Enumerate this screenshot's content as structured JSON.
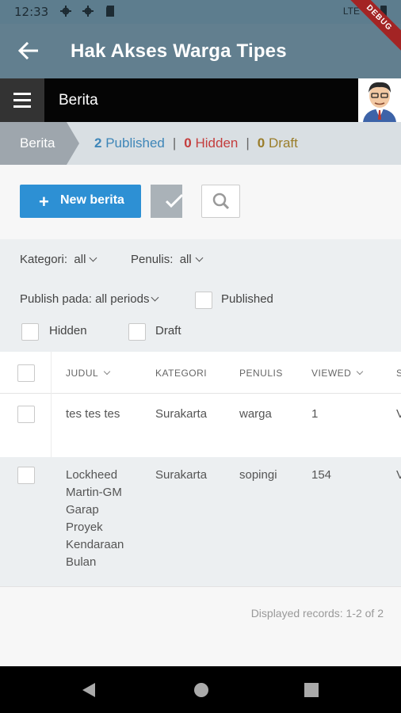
{
  "status_bar": {
    "time": "12:33",
    "network": "LTE"
  },
  "debug_banner": "DEBUG",
  "app_bar": {
    "title": "Hak Akses Warga Tipes"
  },
  "top_nav": {
    "section": "Berita"
  },
  "breadcrumb": {
    "current": "Berita",
    "published_count": "2",
    "published_label": "Published",
    "hidden_count": "0",
    "hidden_label": "Hidden",
    "draft_count": "0",
    "draft_label": "Draft",
    "separator": "|"
  },
  "toolbar": {
    "new_label": "New berita"
  },
  "filters": {
    "kategori_label": "Kategori:",
    "kategori_value": "all",
    "penulis_label": "Penulis:",
    "penulis_value": "all",
    "publish_label": "Publish pada:",
    "publish_value": "all periods",
    "published_checkbox": "Published",
    "hidden_checkbox": "Hidden",
    "draft_checkbox": "Draft"
  },
  "table": {
    "columns": [
      "JUDUL",
      "KATEGORI",
      "PENULIS",
      "VIEWED",
      "S"
    ],
    "rows": [
      {
        "judul": "tes tes tes",
        "kategori": "Surakarta",
        "penulis": "warga",
        "viewed": "1",
        "status": "V"
      },
      {
        "judul": "Lockheed Martin-GM Garap Proyek Kendaraan Bulan",
        "kategori": "Surakarta",
        "penulis": "sopingi",
        "viewed": "154",
        "status": "V"
      }
    ],
    "footer": "Displayed records: 1-2 of 2"
  },
  "colors": {
    "app_bar": "#627f8f",
    "primary_button": "#2d90d4",
    "published": "#3e86b8",
    "hidden": "#c43d3d",
    "draft": "#9a7d2a"
  }
}
